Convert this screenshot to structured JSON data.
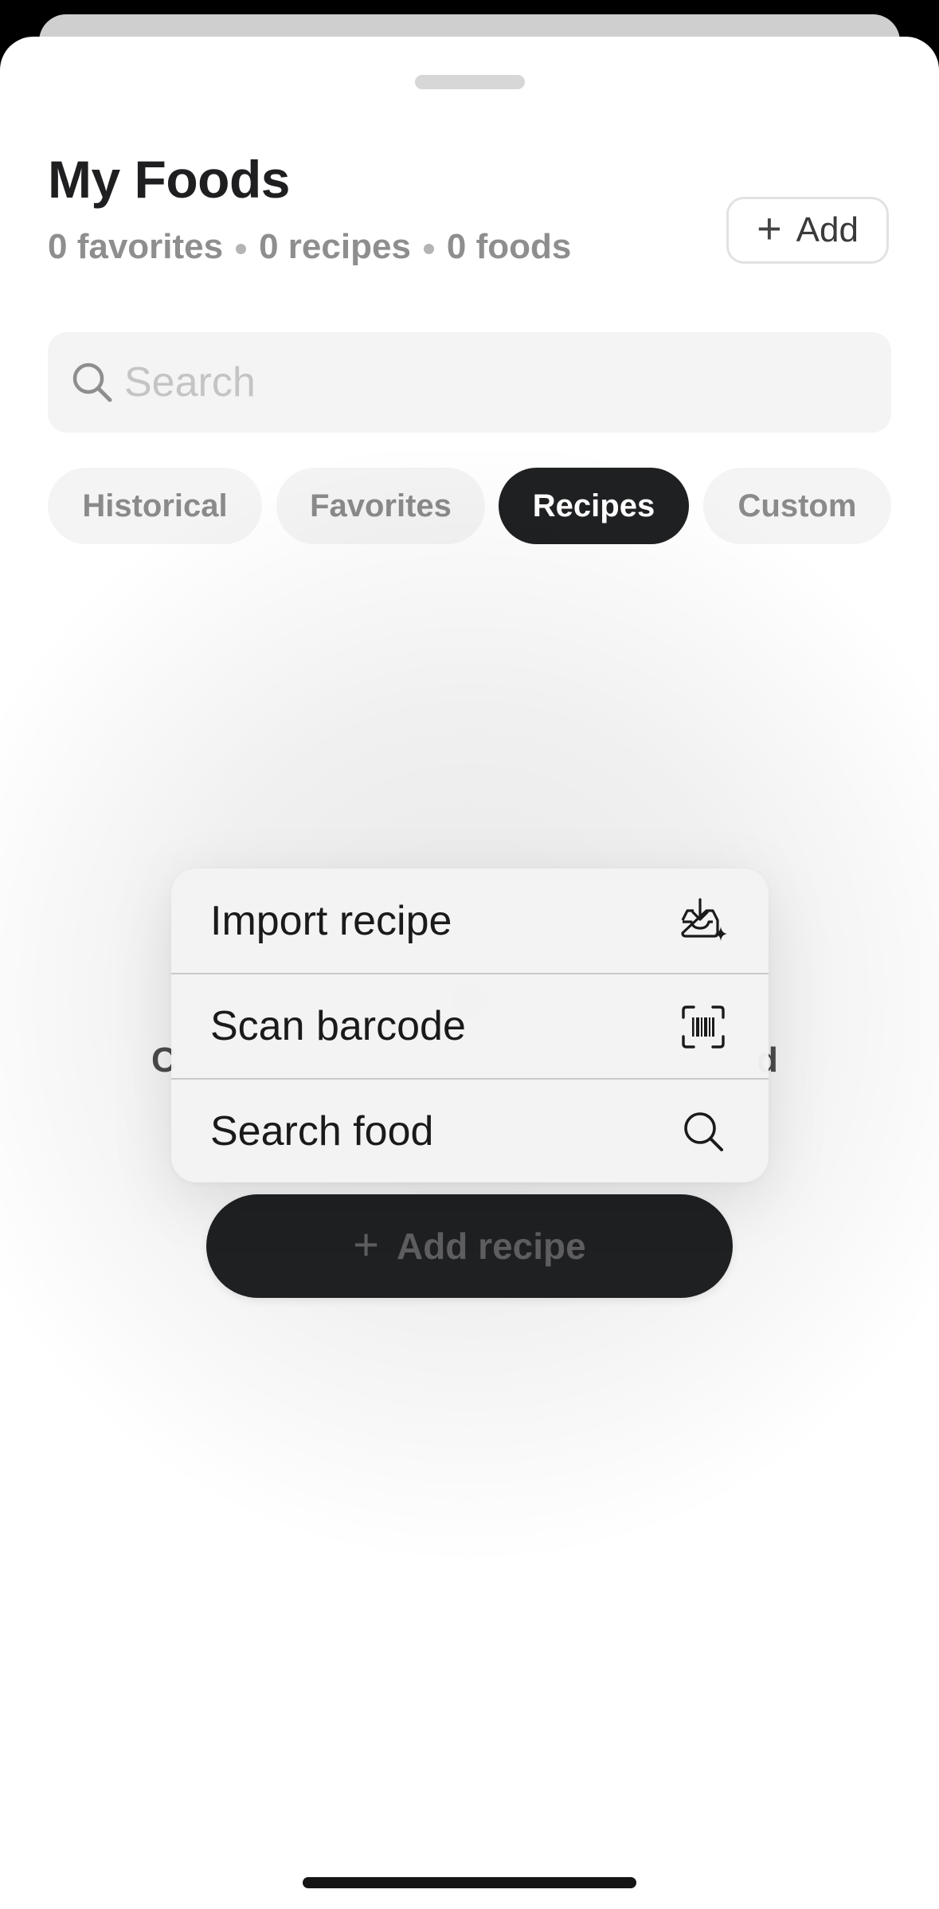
{
  "header": {
    "title": "My Foods",
    "stats": {
      "favorites": "0 favorites",
      "recipes": "0 recipes",
      "foods": "0 foods"
    },
    "add_label": "Add"
  },
  "search": {
    "placeholder": "Search",
    "value": ""
  },
  "tabs": [
    {
      "label": "Historical",
      "active": false
    },
    {
      "label": "Favorites",
      "active": false
    },
    {
      "label": "Recipes",
      "active": true
    },
    {
      "label": "Custom",
      "active": false
    }
  ],
  "empty_state": {
    "text_left_fragment": "C",
    "text_right_fragment": "d"
  },
  "add_recipe_button": {
    "label": "Add recipe"
  },
  "menu": {
    "items": [
      {
        "label": "Import recipe",
        "icon": "import-tray-icon"
      },
      {
        "label": "Scan barcode",
        "icon": "barcode-scan-icon"
      },
      {
        "label": "Search food",
        "icon": "search-icon"
      }
    ]
  },
  "colors": {
    "active_tab": "#1f2022",
    "tab_bg": "#f4f4f4",
    "muted_text": "#8e8e8e"
  }
}
